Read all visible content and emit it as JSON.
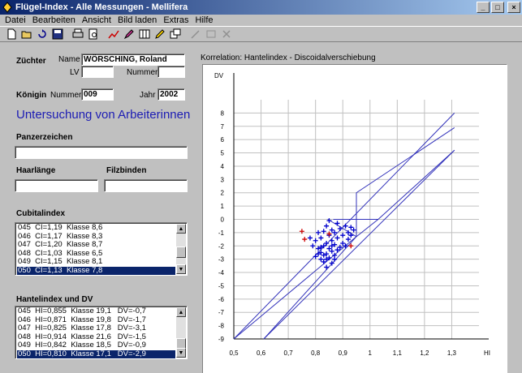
{
  "window": {
    "title": "Flügel-Index - Alle Messungen - Mellifera"
  },
  "menu": [
    "Datei",
    "Bearbeiten",
    "Ansicht",
    "Bild laden",
    "Extras",
    "Hilfe"
  ],
  "toolbar_icons": [
    "new-file-icon",
    "open-folder-icon",
    "refresh-icon",
    "save-icon",
    "print-icon",
    "print-preview-icon",
    "chart-icon",
    "pen-icon",
    "table-icon",
    "pencil-icon",
    "windows-icon",
    "wand-icon",
    "frame-icon",
    "delete-icon"
  ],
  "form": {
    "zuechter_label": "Züchter",
    "name_label": "Name",
    "name_value": "WÖRSCHING, Roland",
    "lv_label": "LV",
    "lv_value": "",
    "nummer_label": "Nummer",
    "nummer_value": "",
    "koenigin_label": "Königin",
    "koenigin_nummer_label": "Nummer",
    "koenigin_nummer_value": "009",
    "jahr_label": "Jahr",
    "jahr_value": "2002",
    "heading": "Untersuchung von Arbeiterinnen",
    "panzerzeichen_label": "Panzerzeichen",
    "panzerzeichen_value": "",
    "haarlaenge_label": "Haarlänge",
    "haarlaenge_value": "",
    "filzbinden_label": "Filzbinden",
    "filzbinden_value": ""
  },
  "cubitalindex": {
    "label": "Cubitalindex",
    "rows": [
      "045  CI=1,19  Klasse 8,6",
      "046  CI=1,17  Klasse 8,3",
      "047  CI=1,20  Klasse 8,7",
      "048  CI=1,03  Klasse 6,5",
      "049  CI=1,15  Klasse 8,1",
      "050  CI=1,13  Klasse 7,8"
    ],
    "selected": 5
  },
  "hantelindex": {
    "label": "Hantelindex und DV",
    "rows": [
      "045  HI=0,855  Klasse 19,1   DV=-0,7",
      "046  HI=0,871  Klasse 19,8   DV=-1,7",
      "047  HI=0,825  Klasse 17,8   DV=-3,1",
      "048  HI=0,914  Klasse 21,6   DV=-1,5",
      "049  HI=0,842  Klasse 18,5   DV=-0,9",
      "050  HI=0,810  Klasse 17,1   DV=-2,9"
    ],
    "selected": 5
  },
  "chart_data": {
    "type": "scatter",
    "title": "Korrelation: Hantelindex - Discoidalverschiebung",
    "xlabel": "HI",
    "ylabel": "DV",
    "xlim": [
      0.5,
      1.4
    ],
    "ylim": [
      -9,
      9
    ],
    "xticks": [
      "0,5",
      "0,6",
      "0,7",
      "0,8",
      "0,9",
      "1",
      "1,1",
      "1,2",
      "1,3"
    ],
    "xtick_values": [
      0.5,
      0.6,
      0.7,
      0.8,
      0.9,
      1.0,
      1.1,
      1.2,
      1.3
    ],
    "yticks": [
      8,
      7,
      6,
      5,
      4,
      3,
      2,
      1,
      0,
      -1,
      -2,
      -3,
      -4,
      -5,
      -6,
      -7,
      -8,
      -9
    ],
    "grid": true,
    "colors": {
      "lines": "#3333bb",
      "points_blue": "#0000cc",
      "points_red": "#cc0000",
      "grid": "#c0c0c0"
    },
    "lines": [
      {
        "points": [
          [
            0.5,
            -9
          ],
          [
            1.31,
            8
          ]
        ]
      },
      {
        "points": [
          [
            0.61,
            -9
          ],
          [
            1.31,
            5.2
          ]
        ]
      },
      {
        "points": [
          [
            0.5,
            -9
          ],
          [
            0.95,
            -1.3
          ],
          [
            0.95,
            2
          ],
          [
            1.31,
            6.9
          ]
        ]
      },
      {
        "points": [
          [
            0.61,
            -9
          ],
          [
            0.95,
            -1.3
          ],
          [
            1.03,
            0
          ],
          [
            1.31,
            5.2
          ]
        ]
      },
      {
        "points": [
          [
            0.865,
            0
          ],
          [
            1.03,
            0
          ]
        ]
      },
      {
        "points": [
          [
            0.845,
            0
          ],
          [
            0.95,
            -1.3
          ]
        ]
      }
    ],
    "series": [
      {
        "color": "#0000cc",
        "points": [
          [
            0.78,
            -1.4
          ],
          [
            0.79,
            -2.0
          ],
          [
            0.8,
            -2.8
          ],
          [
            0.8,
            -1.6
          ],
          [
            0.81,
            -1.0
          ],
          [
            0.81,
            -2.2
          ],
          [
            0.82,
            -3.0
          ],
          [
            0.82,
            -2.5
          ],
          [
            0.82,
            -1.4
          ],
          [
            0.83,
            -2.0
          ],
          [
            0.83,
            -3.2
          ],
          [
            0.83,
            -0.9
          ],
          [
            0.84,
            -2.6
          ],
          [
            0.84,
            -1.8
          ],
          [
            0.84,
            -0.5
          ],
          [
            0.84,
            -3.6
          ],
          [
            0.85,
            -2.2
          ],
          [
            0.85,
            -1.2
          ],
          [
            0.85,
            -2.9
          ],
          [
            0.85,
            -0.1
          ],
          [
            0.86,
            -1.6
          ],
          [
            0.86,
            -2.4
          ],
          [
            0.86,
            -0.8
          ],
          [
            0.86,
            -3.3
          ],
          [
            0.87,
            -1.9
          ],
          [
            0.87,
            -1.0
          ],
          [
            0.87,
            -2.7
          ],
          [
            0.88,
            -2.3
          ],
          [
            0.88,
            -0.3
          ],
          [
            0.88,
            -1.4
          ],
          [
            0.89,
            -2.1
          ],
          [
            0.89,
            -0.7
          ],
          [
            0.9,
            -1.8
          ],
          [
            0.9,
            -1.2
          ],
          [
            0.91,
            -0.5
          ],
          [
            0.91,
            -2.0
          ],
          [
            0.92,
            -1.0
          ],
          [
            0.92,
            -1.5
          ],
          [
            0.93,
            -0.6
          ],
          [
            0.93,
            -1.2
          ],
          [
            0.94,
            -0.8
          ],
          [
            0.81,
            -2.6
          ],
          [
            0.82,
            -2.1
          ],
          [
            0.83,
            -2.7
          ],
          [
            0.84,
            -3.0
          ],
          [
            0.86,
            -2.0
          ],
          [
            0.87,
            -3.0
          ]
        ]
      },
      {
        "color": "#cc0000",
        "points": [
          [
            0.75,
            -0.9
          ],
          [
            0.76,
            -1.5
          ],
          [
            0.85,
            -1.1
          ],
          [
            0.93,
            -2.0
          ]
        ]
      }
    ]
  }
}
